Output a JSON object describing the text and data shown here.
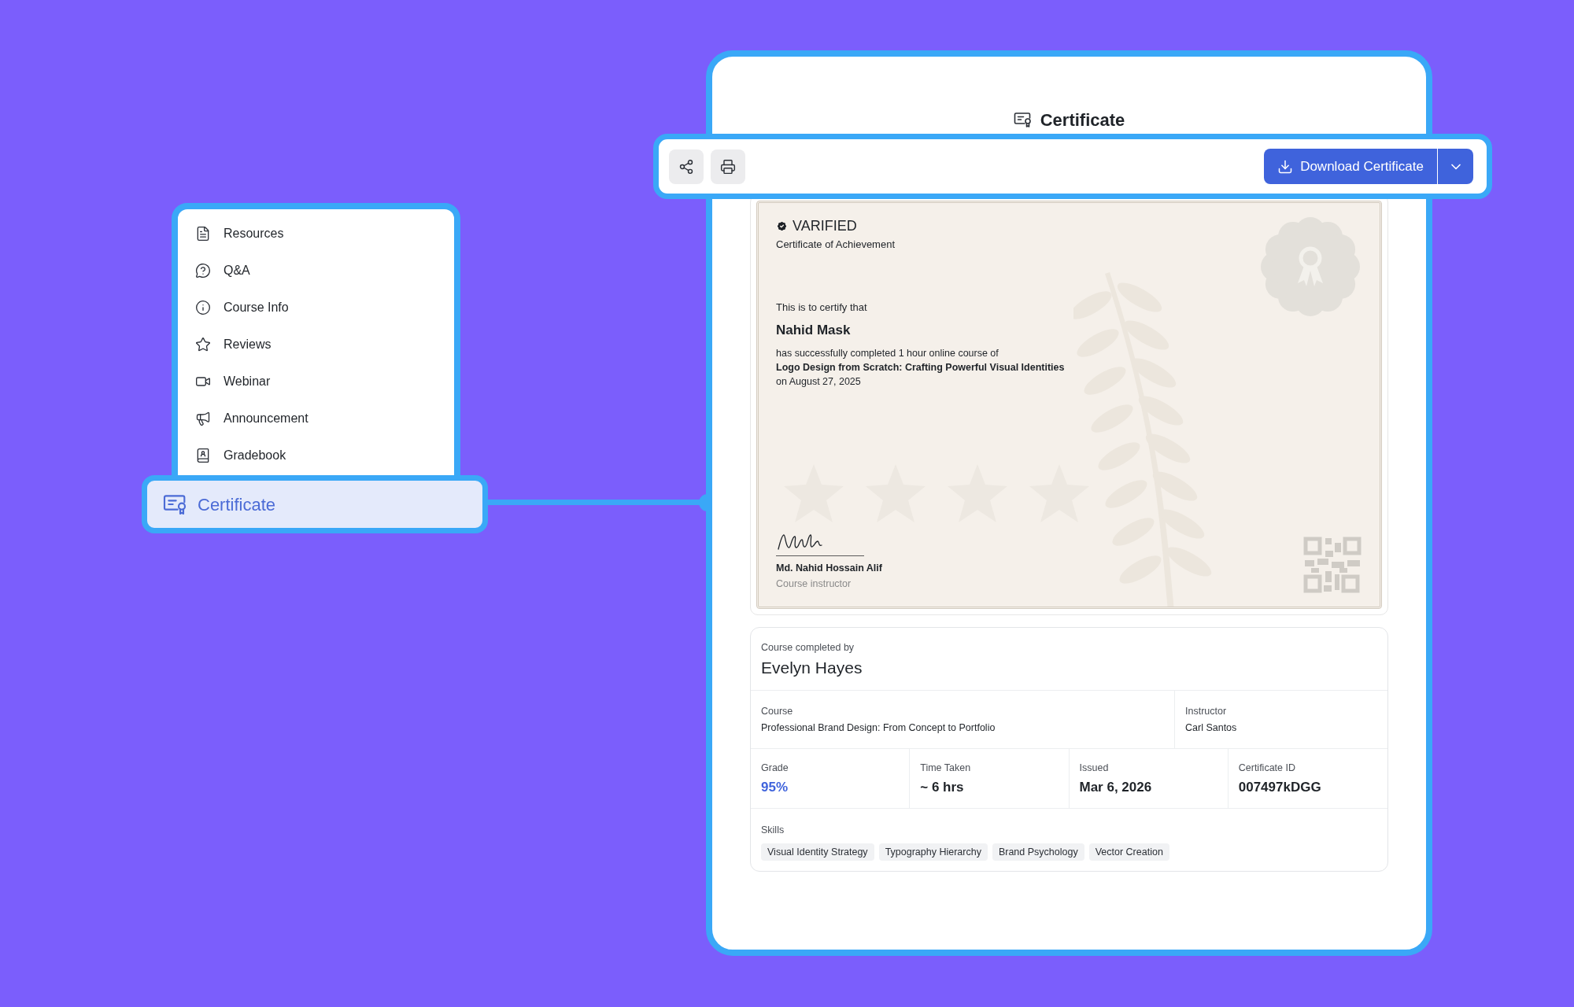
{
  "sidebar": {
    "items": [
      {
        "label": "Resources",
        "selected": false
      },
      {
        "label": "Q&A",
        "selected": false
      },
      {
        "label": "Course Info",
        "selected": false
      },
      {
        "label": "Reviews",
        "selected": false
      },
      {
        "label": "Webinar",
        "selected": false
      },
      {
        "label": "Announcement",
        "selected": false
      },
      {
        "label": "Gradebook",
        "selected": false
      },
      {
        "label": "Certificate",
        "selected": true
      }
    ]
  },
  "panel": {
    "title": "Certificate"
  },
  "toolbar": {
    "download_label": "Download Certificate"
  },
  "certificate": {
    "status": "VARIFIED",
    "subtitle": "Certificate of Achievement",
    "intro": "This is to certify that",
    "recipient": "Nahid Mask",
    "body": "has successfully completed 1 hour online course of",
    "course": "Logo Design from Scratch: Crafting Powerful Visual Identities",
    "date": "on August 27, 2025",
    "signer": "Md. Nahid Hossain Alif",
    "signer_role": "Course instructor"
  },
  "details": {
    "completed_by_label": "Course completed by",
    "completed_by": "Evelyn Hayes",
    "fields": [
      {
        "label": "Course",
        "value": "Professional Brand Design: From Concept to Portfolio"
      },
      {
        "label": "Instructor",
        "value": "Carl Santos"
      }
    ],
    "stats": [
      {
        "label": "Grade",
        "value": "95%",
        "highlight": true
      },
      {
        "label": "Time Taken",
        "value": "~ 6 hrs",
        "highlight": false
      },
      {
        "label": "Issued",
        "value": "Mar 6, 2026",
        "highlight": false
      },
      {
        "label": "Certificate ID",
        "value": "007497kDGG",
        "highlight": false
      }
    ],
    "skills_label": "Skills",
    "skills": [
      "Visual Identity Strategy",
      "Typography Hierarchy",
      "Brand Psychology",
      "Vector Creation"
    ]
  }
}
